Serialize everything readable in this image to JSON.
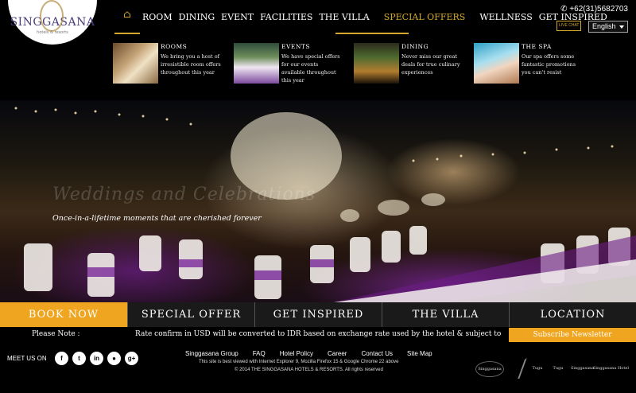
{
  "brand": {
    "logo_text": "SINGGASANA",
    "logo_sub": "hotels & resorts"
  },
  "nav": {
    "home_icon": "home-icon",
    "items": [
      {
        "label": "ROOM"
      },
      {
        "label": "DINING"
      },
      {
        "label": "EVENT"
      },
      {
        "label": "FACILITIES"
      },
      {
        "label": "THE VILLA"
      },
      {
        "label": "SPECIAL OFFERS"
      },
      {
        "label": "WELLNESS"
      },
      {
        "label": "GET INSPIRED"
      }
    ],
    "active": "SPECIAL OFFERS"
  },
  "header": {
    "phone": "+62(31)5682703",
    "live_chat": "LIVE CHAT",
    "language": "English"
  },
  "mega_menu": [
    {
      "title": "ROOMS",
      "desc": "We bring you a host of irresistible room offers throughout this year"
    },
    {
      "title": "EVENTS",
      "desc": "We have special offers for our events available throughout this year"
    },
    {
      "title": "DINING",
      "desc": "Never miss our great deals for true culinary experiences"
    },
    {
      "title": "THE SPA",
      "desc": "Our spa offers some fantastic promotions you can't resist"
    }
  ],
  "hero": {
    "title": "Weddings and Celebrations",
    "subtitle": "Once-in-a-lifetime moments that are cherished forever"
  },
  "actions": [
    {
      "label": "BOOK NOW"
    },
    {
      "label": "SPECIAL OFFER"
    },
    {
      "label": "GET INSPIRED"
    },
    {
      "label": "THE VILLA"
    },
    {
      "label": "LOCATION"
    }
  ],
  "note": {
    "label": "Please Note :",
    "text": "Rate confirm in USD will be converted to IDR based on exchange rate used by the hotel & subject to",
    "subscribe": "Subscribe Newsletter"
  },
  "footer": {
    "meet_us": "MEET US ON",
    "links": [
      "Singgasana Group",
      "FAQ",
      "Hotel Policy",
      "Career",
      "Contact Us",
      "Site Map"
    ],
    "browser_note": "This site is best viewed with Internet Explorer 9, Mozilla Firefox 15 & Google Chrome 22 above",
    "copyright": "© 2014 THE SINGGASANA HOTELS & RESORTS. All rights reserved",
    "brands": [
      "Singgasana",
      "Tugu",
      "Tugu",
      "Singgasana",
      "Singgasana",
      "Hotel"
    ]
  },
  "colors": {
    "accent": "#efa51f",
    "gold": "#d4a92b"
  }
}
